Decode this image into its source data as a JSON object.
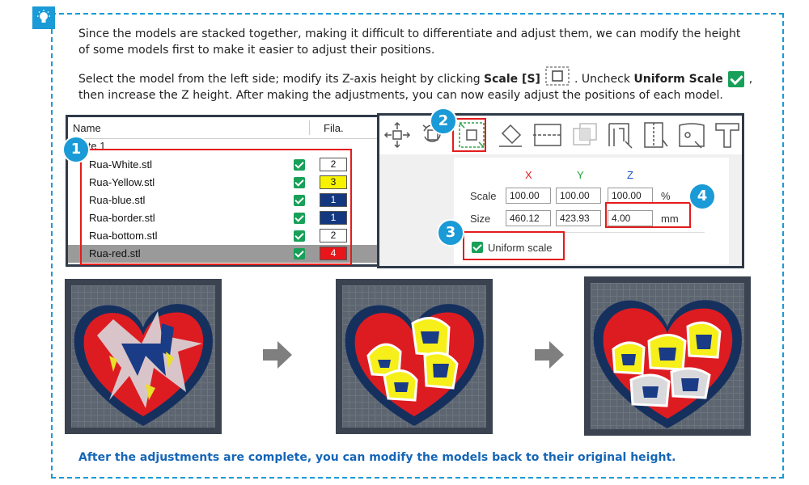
{
  "intro_text": "Since the models are stacked together, making it difficult to differentiate and adjust them, we can modify the height of some models first to make it easier to adjust their positions.",
  "instruction": {
    "part1": "Select the model from the left side; modify its Z-axis height by clicking ",
    "scale_label": "Scale [S]",
    "part2": ". Uncheck ",
    "uniform_label": "Uniform Scale",
    "part3": ",",
    "line2": "then increase the Z height. After making the adjustments, you can now easily adjust the positions of each model."
  },
  "object_list": {
    "col_name": "Name",
    "col_fila": "Fila.",
    "plate": "Plate 1",
    "items": [
      {
        "name": "Rua-White.stl",
        "fila": "2",
        "color": "#ffffff",
        "text_color": "#111111"
      },
      {
        "name": "Rua-Yellow.stl",
        "fila": "3",
        "color": "#f6f200",
        "text_color": "#111111"
      },
      {
        "name": "Rua-blue.stl",
        "fila": "1",
        "color": "#14387f",
        "text_color": "#ffffff"
      },
      {
        "name": "Rua-border.stl",
        "fila": "1",
        "color": "#14387f",
        "text_color": "#ffffff"
      },
      {
        "name": "Rua-bottom.stl",
        "fila": "2",
        "color": "#ffffff",
        "text_color": "#111111"
      },
      {
        "name": "Rua-red.stl",
        "fila": "4",
        "color": "#e8151b",
        "text_color": "#ffffff"
      }
    ]
  },
  "scale_panel": {
    "x_label": "X",
    "y_label": "Y",
    "z_label": "Z",
    "scale_row_label": "Scale",
    "size_row_label": "Size",
    "scale_x": "100.00",
    "scale_y": "100.00",
    "scale_z": "100.00",
    "scale_unit": "%",
    "size_x": "460.12",
    "size_y": "423.93",
    "size_z": "4.00",
    "size_unit": "mm",
    "uniform_scale_label": "Uniform scale"
  },
  "callouts": [
    "1",
    "2",
    "3",
    "4"
  ],
  "toolbar_icons": [
    "move-icon",
    "rotate-icon",
    "scale-icon",
    "lay-on-face-icon",
    "cut-icon",
    "boolean-icon",
    "support-paint-icon",
    "seam-paint-icon",
    "color-paint-icon",
    "text-icon"
  ],
  "colors": {
    "accent": "#1a9ad6",
    "highlight": "#e31c1c",
    "check": "#18a058",
    "footer_text": "#1566b7"
  },
  "footer": "After the adjustments are complete, you can modify the models back to their original height."
}
